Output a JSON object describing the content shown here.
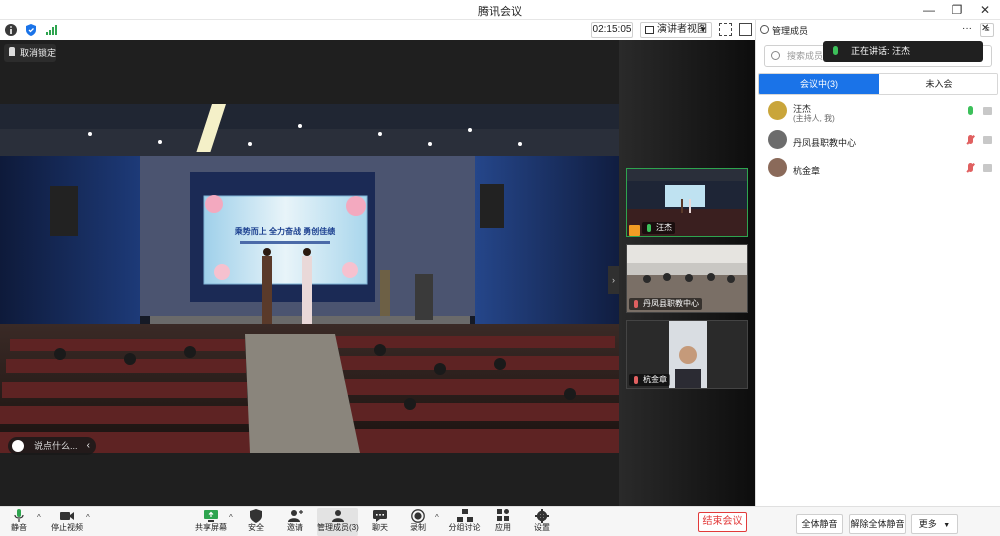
{
  "window": {
    "title": "腾讯会议",
    "minimize": "—",
    "restore": "❐",
    "close": "✕"
  },
  "toprow": {
    "timer": "02:15:05",
    "view_mode": "演讲者视图",
    "view_caret": "▼"
  },
  "stage": {
    "unpin_label": "取消锁定",
    "chat_placeholder": "说点什么...",
    "chat_chevron": "‹",
    "side_handle": "›",
    "slide_text": "乘势而上  全力奋战  勇创佳绩",
    "thumbnails": [
      {
        "name": "汪杰"
      },
      {
        "name": "丹凤县职教中心"
      },
      {
        "name": "杭金章"
      }
    ]
  },
  "panel": {
    "title": "管理成员",
    "more": "···",
    "close": "✕",
    "search_placeholder": "搜索成员",
    "speaking_label": "正在讲话: 汪杰",
    "menu_glyph": "≡",
    "tabs": {
      "in_meeting": "会议中(3)",
      "not_joined": "未入会"
    },
    "members": [
      {
        "name": "汪杰",
        "role": "(主持人, 我)",
        "mic": "on"
      },
      {
        "name": "丹凤县职教中心",
        "role": "",
        "mic": "off"
      },
      {
        "name": "杭金章",
        "role": "",
        "mic": "off"
      }
    ]
  },
  "toolbar": {
    "mute": "静音",
    "stop_video": "停止视频",
    "share_screen": "共享屏幕",
    "security": "安全",
    "invite": "邀请",
    "manage_members": "管理成员(3)",
    "chat": "聊天",
    "record": "录制",
    "breakout": "分组讨论",
    "apps": "应用",
    "settings": "设置",
    "end_meeting": "结束会议",
    "mute_all": "全体静音",
    "unmute_all": "解除全体静音",
    "more": "更多",
    "more_caret": "▼",
    "caret": "^"
  },
  "colors": {
    "accent": "#1a73e8",
    "end": "#e23a3a",
    "mic_on": "#3cc05a",
    "mic_off": "#e06060"
  }
}
